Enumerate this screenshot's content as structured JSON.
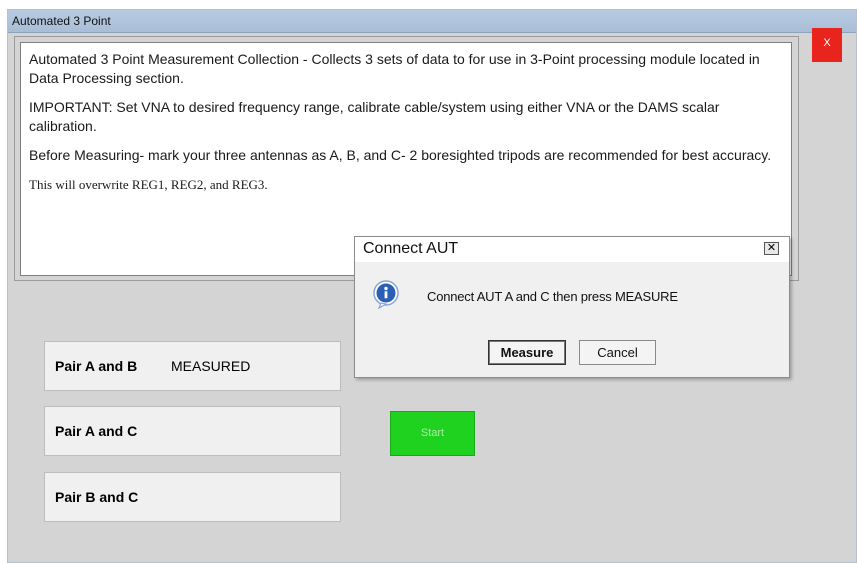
{
  "window": {
    "title": "Automated 3 Point",
    "close_label": "X"
  },
  "description": {
    "paragraphs": [
      "Automated 3 Point Measurement Collection - Collects 3 sets of data to for use in 3-Point processing module located in Data Processing section.",
      "IMPORTANT: Set VNA to desired frequency range, calibrate cable/system using either VNA or the DAMS  scalar calibration.",
      "Before Measuring- mark your three antennas as A, B, and C-  2 boresighted tripods are recommended for best accuracy."
    ],
    "warning": "This will overwrite REG1, REG2, and REG3."
  },
  "pairs": [
    {
      "label": "Pair A and B",
      "status": "MEASURED"
    },
    {
      "label": "Pair A and C",
      "status": ""
    },
    {
      "label": "Pair B and C",
      "status": ""
    }
  ],
  "start_button": {
    "label": "Start"
  },
  "dialog": {
    "title": "Connect AUT",
    "close_glyph": "✕",
    "icon": "info-icon",
    "message": "Connect AUT A and C then press MEASURE",
    "measure_label": "Measure",
    "cancel_label": "Cancel"
  },
  "colors": {
    "close_button": "#e8241d",
    "start_button": "#1fd21f",
    "titlebar": "#a9bdd7",
    "info_icon": "#2a5fb5"
  }
}
